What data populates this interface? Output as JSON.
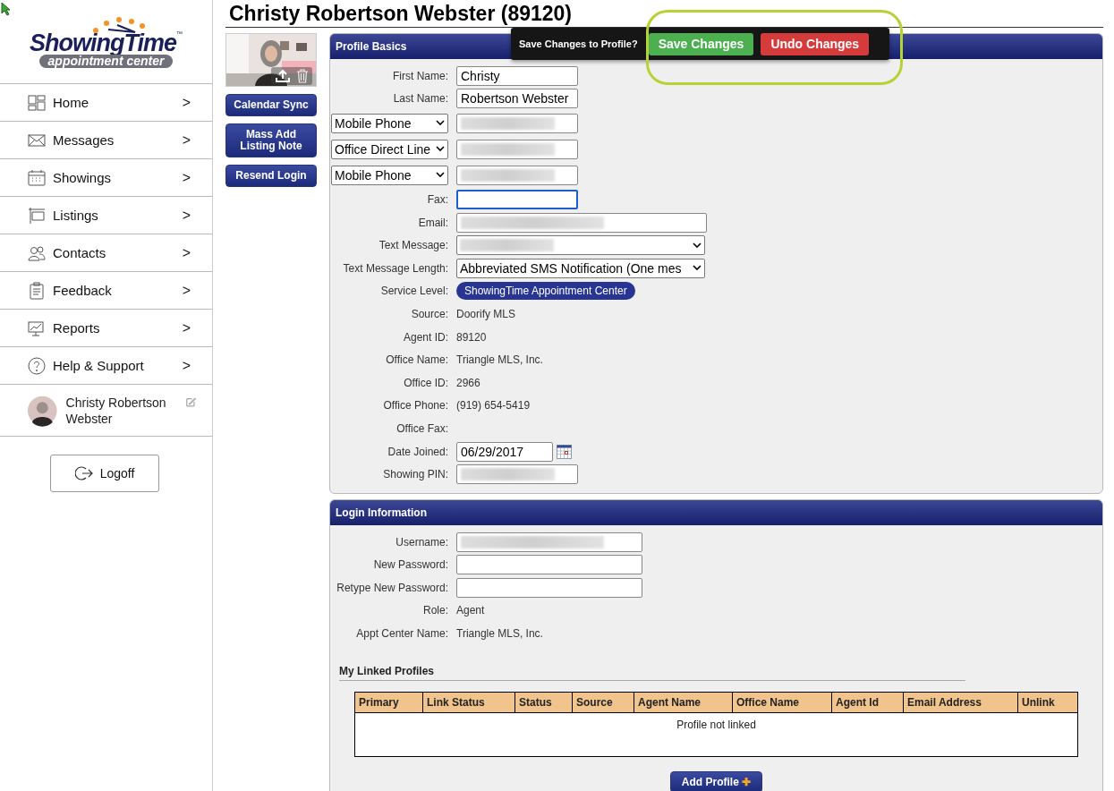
{
  "logo": {
    "name": "ShowingTime",
    "tm": "™",
    "tagline": "appointment center"
  },
  "sidebar": {
    "items": [
      {
        "label": "Home",
        "arrow": ">"
      },
      {
        "label": "Messages",
        "arrow": ">"
      },
      {
        "label": "Showings",
        "arrow": ">"
      },
      {
        "label": "Listings",
        "arrow": ">"
      },
      {
        "label": "Contacts",
        "arrow": ">"
      },
      {
        "label": "Feedback",
        "arrow": ">"
      },
      {
        "label": "Reports",
        "arrow": ">"
      },
      {
        "label": "Help & Support",
        "arrow": ">"
      }
    ],
    "user": {
      "name": "Christy Robertson Webster"
    },
    "logoff": "Logoff"
  },
  "page_title": "Christy Robertson Webster (89120)",
  "side_buttons": [
    "Calendar Sync",
    "Mass Add Listing Note",
    "Resend Login"
  ],
  "save_bar": {
    "prompt": "Save Changes to Profile?",
    "save": "Save Changes",
    "undo": "Undo Changes"
  },
  "profile_basics": {
    "title": "Profile Basics",
    "rows": [
      {
        "kind": "input",
        "label": "First Name:",
        "value": "Christy",
        "focused": false
      },
      {
        "kind": "input",
        "label": "Last Name:",
        "value": "Robertson Webster",
        "focused": false
      },
      {
        "kind": "phone",
        "type": "Mobile Phone"
      },
      {
        "kind": "phone",
        "type": "Office Direct Line"
      },
      {
        "kind": "phone",
        "type": "Mobile Phone"
      },
      {
        "kind": "input",
        "label": "Fax:",
        "focused": true
      },
      {
        "kind": "masked_wide",
        "label": "Email:"
      },
      {
        "kind": "masked_select",
        "label": "Text Message:"
      },
      {
        "kind": "select",
        "label": "Text Message Length:",
        "value": "Abbreviated SMS Notification (One mes"
      },
      {
        "kind": "badge",
        "label": "Service Level:",
        "value": "ShowingTime Appointment Center"
      },
      {
        "kind": "static",
        "label": "Source:",
        "value": "Doorify MLS"
      },
      {
        "kind": "static",
        "label": "Agent ID:",
        "value": "89120"
      },
      {
        "kind": "static",
        "label": "Office Name:",
        "value": "Triangle MLS, Inc."
      },
      {
        "kind": "static",
        "label": "Office ID:",
        "value": "2966"
      },
      {
        "kind": "static",
        "label": "Office Phone:",
        "value": "(919) 654-5419"
      },
      {
        "kind": "static",
        "label": "Office Fax:"
      },
      {
        "kind": "date",
        "label": "Date Joined:",
        "value": "06/29/2017"
      },
      {
        "kind": "masked",
        "label": "Showing PIN:"
      }
    ]
  },
  "login_information": {
    "title": "Login Information",
    "rows": [
      {
        "kind": "masked",
        "label": "Username:"
      },
      {
        "kind": "input",
        "label": "New Password:",
        "focused": false
      },
      {
        "kind": "input",
        "label": "Retype New Password:",
        "focused": false
      },
      {
        "kind": "static",
        "label": "Role:",
        "value": "Agent"
      },
      {
        "kind": "static",
        "label": "Appt Center Name:",
        "value": "Triangle MLS, Inc."
      }
    ],
    "linked_profiles": {
      "title": "My Linked Profiles",
      "columns": [
        "Primary",
        "Link Status",
        "Status",
        "Source",
        "Agent Name",
        "Office Name",
        "Agent Id",
        "Email Address",
        "Unlink"
      ],
      "empty": "Profile not linked"
    },
    "add_button": {
      "label": "Add Profile",
      "icon": "✚"
    }
  }
}
